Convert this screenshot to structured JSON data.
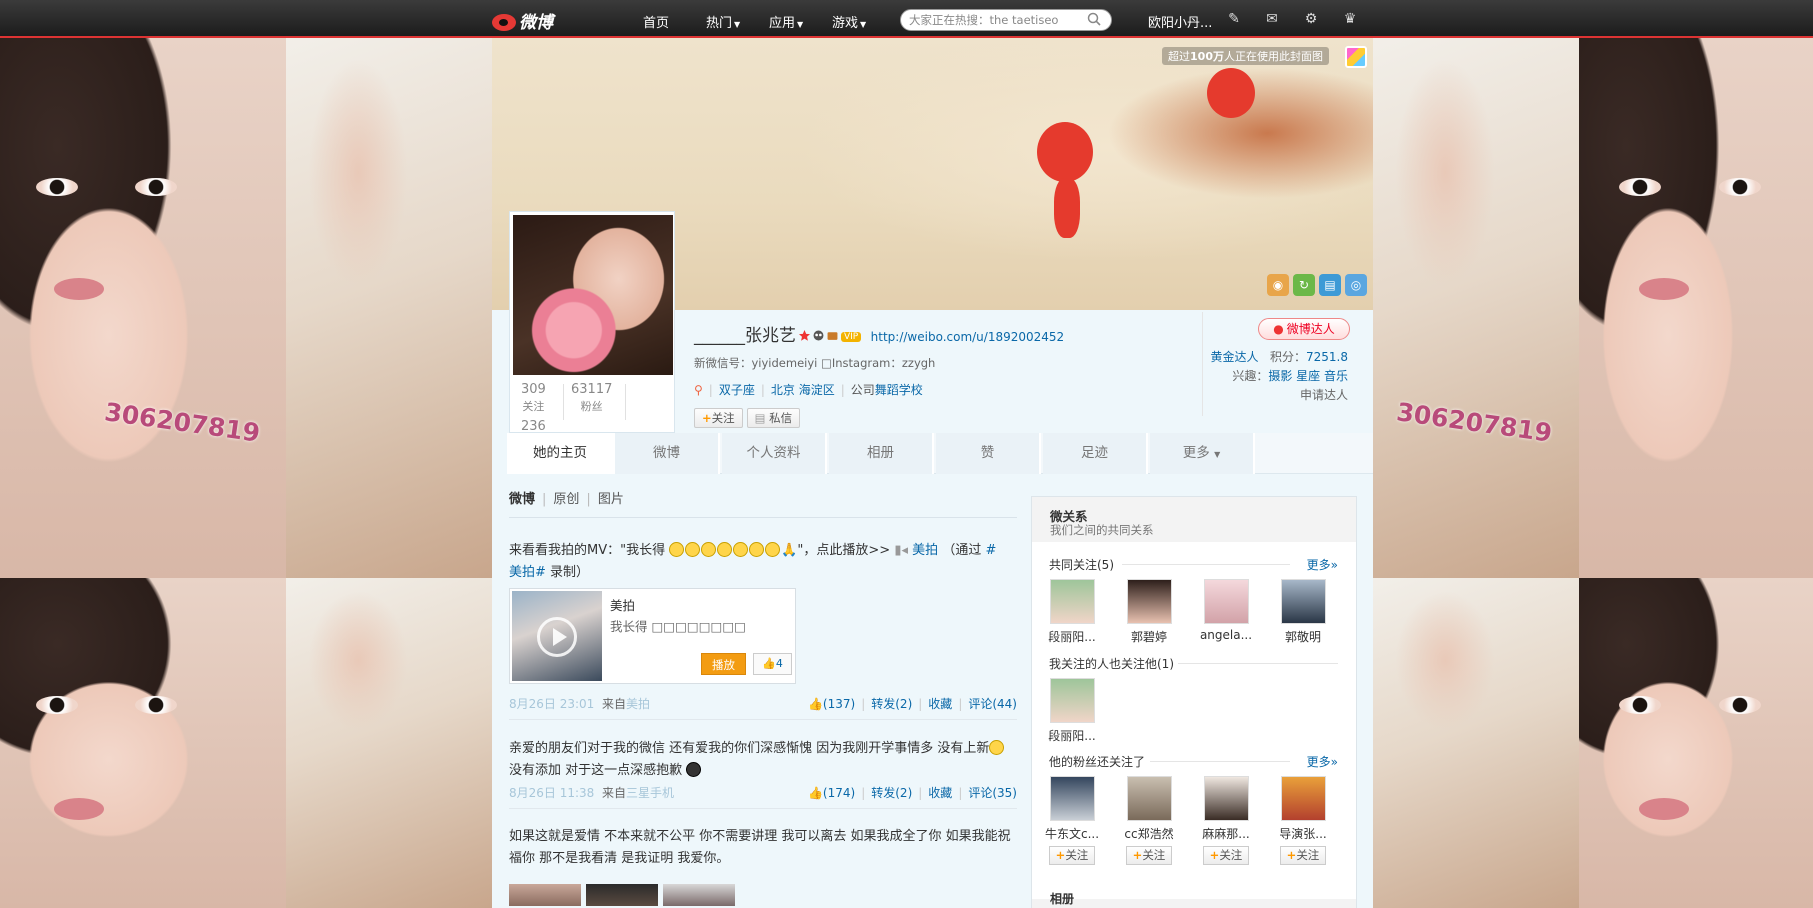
{
  "background": {
    "watermark": "306207819"
  },
  "topbar": {
    "logo": "微博",
    "nav": [
      {
        "label": "首页",
        "caret": false
      },
      {
        "label": "热门",
        "caret": true
      },
      {
        "label": "应用",
        "caret": true
      },
      {
        "label": "游戏",
        "caret": true
      }
    ],
    "search_placeholder": "大家正在热搜：the taetiseo",
    "username": "欧阳小丹...",
    "icons": [
      "compose-icon",
      "message-icon",
      "gear-icon",
      "crown-icon"
    ]
  },
  "cover": {
    "note_prefix": "超过",
    "note_bold": "100万",
    "note_suffix": "人正在使用此封面图"
  },
  "profile": {
    "name": "______张兆艺",
    "vip_badge": "VIP",
    "url": "http://weibo.com/u/1892002452",
    "subline": "新微信号：yiyidemeiyi □Instagram：zzygh",
    "tags": [
      "双子座",
      "北京 海淀区"
    ],
    "company_prefix": "公司",
    "company": "舞蹈学校",
    "follow_btn": "关注",
    "message_btn": "私信",
    "stats": [
      {
        "num": "309",
        "label": "关注"
      },
      {
        "num": "63117",
        "label": "粉丝"
      },
      {
        "num": "236",
        "label": ""
      }
    ]
  },
  "rightinfo": {
    "badge": "微博达人",
    "level_label": "黄金达人",
    "score_label": "积分：",
    "score": "7251.8",
    "interest_label": "兴趣：",
    "interests": "摄影 星座 音乐",
    "apply": "申请达人"
  },
  "tabs": [
    "她的主页",
    "微博",
    "个人资料",
    "相册",
    "赞",
    "足迹",
    "更多"
  ],
  "feed": {
    "filters": [
      "微博",
      "原创",
      "图片"
    ],
    "posts": [
      {
        "text_a": "来看看我拍的MV：\"我长得 ",
        "text_b": "\"，点此播放>> ",
        "link": "美拍",
        "text_c": "（通过 ",
        "hashtag_a": "#",
        "hashtag_b": "美拍#",
        "text_d": " 录制）",
        "card_title": "美拍",
        "card_desc": "我长得 □□□□□□□□",
        "card_play": "播放",
        "card_likes": "4",
        "time": "8月26日 23:01",
        "source_label": "来自",
        "source": "美拍",
        "likes": "(137)",
        "repost": "转发(2)",
        "fav": "收藏",
        "comment": "评论(44)"
      },
      {
        "text_a": "亲爱的朋友们对于我的微信 还有爱我的你们深感惭愧 因为我刚开学事情多 没有上新",
        "text_b": "没有添加 对于这一点深感抱歉",
        "time": "8月26日 11:38",
        "source_label": "来自",
        "source": "三星手机",
        "likes": "(174)",
        "repost": "转发(2)",
        "fav": "收藏",
        "comment": "评论(35)"
      },
      {
        "text_a": "如果这就是爱情 不本来就不公平 你不需要讲理 我可以离去 如果我成全了你 如果我能祝",
        "text_b": "福你 那不是我看清 是我证明 我爱你。"
      }
    ]
  },
  "sidebar": {
    "title": "微关系",
    "subtitle": "我们之间的共同关系",
    "common_follow": "共同关注(5)",
    "more": "更多»",
    "common_users": [
      "段丽阳...",
      "郭碧婷",
      "angela...",
      "郭敬明"
    ],
    "also_follow": "我关注的人也关注他(1)",
    "also_users": [
      "段丽阳..."
    ],
    "fans_follow": "他的粉丝还关注了",
    "fan_users": [
      "牛东文c...",
      "cc郑浩然",
      "麻麻那...",
      "导演张..."
    ],
    "follow_btn": "关注",
    "bottom_label": "相册"
  }
}
